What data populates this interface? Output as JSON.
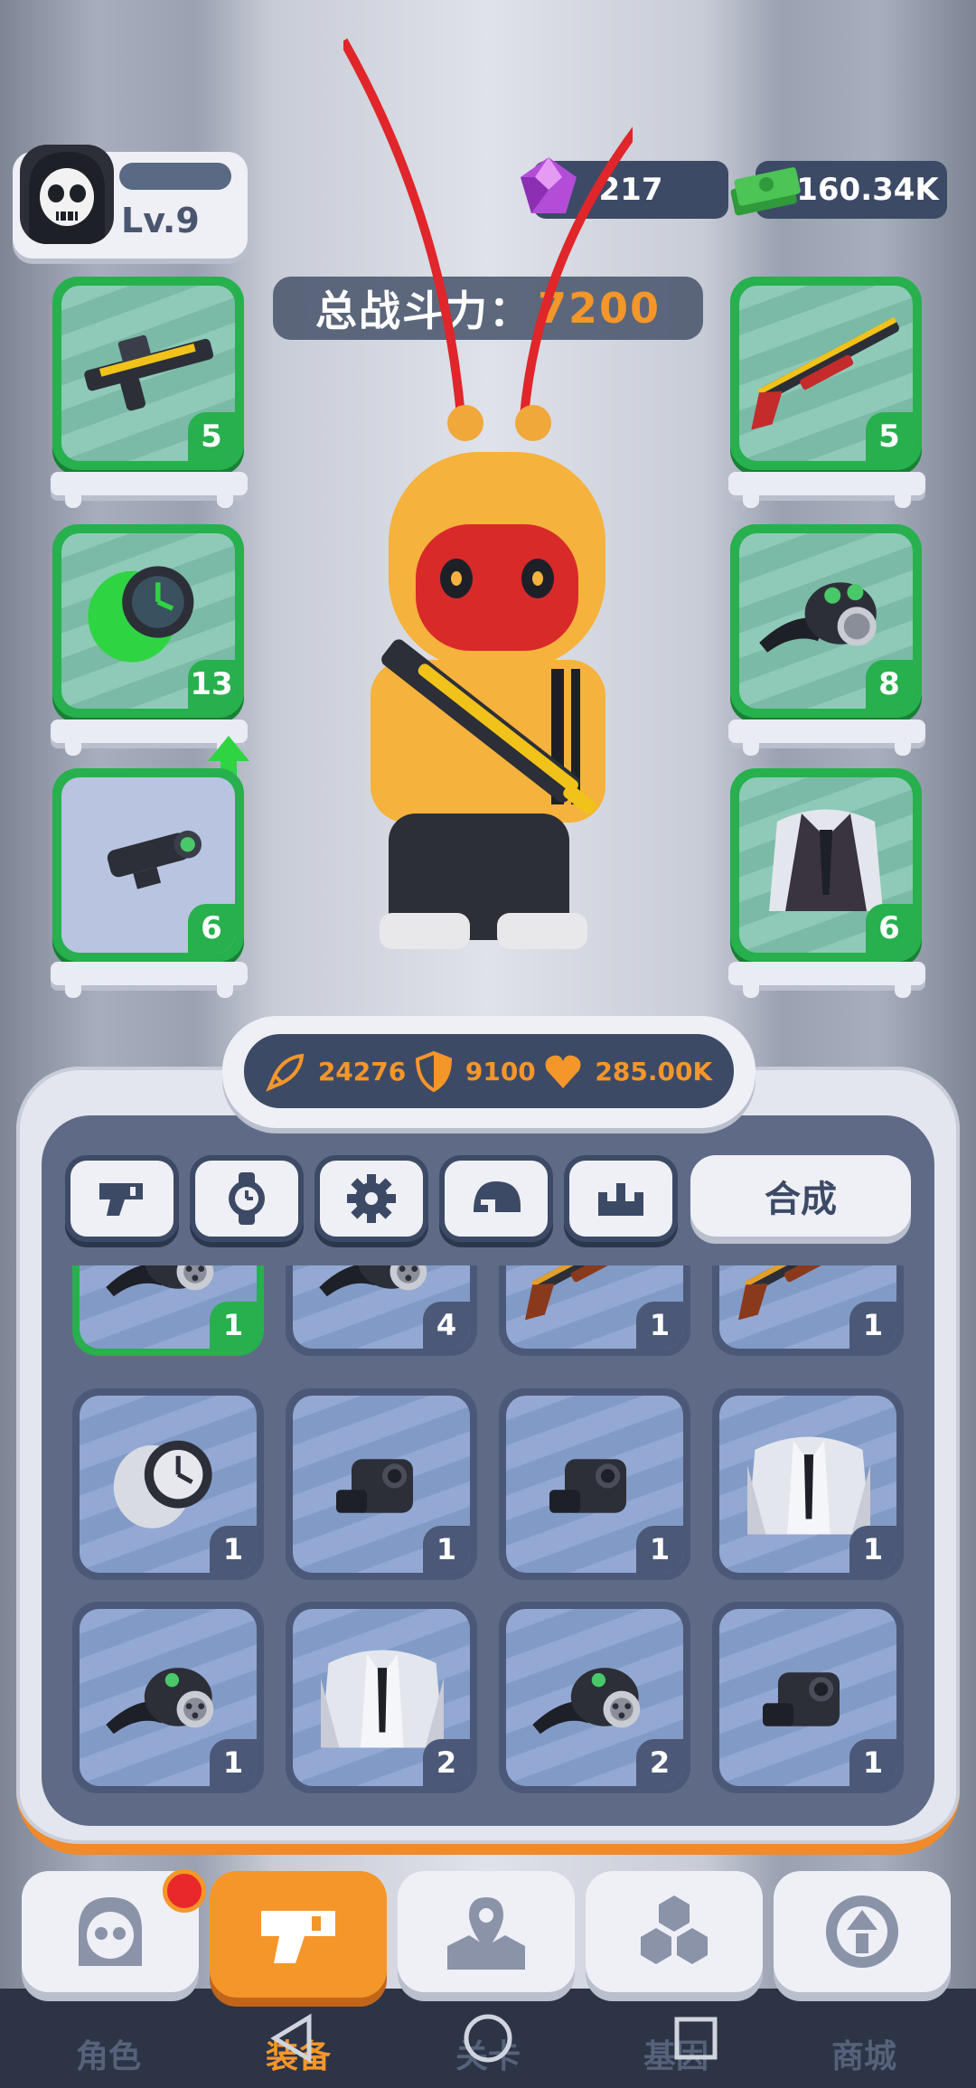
{
  "player": {
    "level": "Lv.9",
    "avatar_icon": "skull-hood-icon"
  },
  "currency": {
    "gems": "217",
    "cash": "160.34K"
  },
  "power": {
    "label": "总战斗力：",
    "value": "7200"
  },
  "equipment": {
    "left": [
      {
        "icon": "rifle-icon",
        "count": "5"
      },
      {
        "icon": "watch-icon",
        "count": "13"
      },
      {
        "icon": "scope-icon",
        "count": "6"
      }
    ],
    "right": [
      {
        "icon": "shotgun-icon",
        "count": "5"
      },
      {
        "icon": "gas-mask-icon",
        "count": "8"
      },
      {
        "icon": "vest-icon",
        "count": "6"
      }
    ]
  },
  "stats": {
    "attack": "24276",
    "defense": "9100",
    "health": "285.00K"
  },
  "tabs": [
    {
      "icon": "gun-icon"
    },
    {
      "icon": "watch-icon"
    },
    {
      "icon": "gear-icon"
    },
    {
      "icon": "helmet-icon"
    },
    {
      "icon": "crown-icon"
    }
  ],
  "merge_label": "合成",
  "inventory": [
    {
      "icon": "gas-mask-icon",
      "count": "1",
      "selected": true
    },
    {
      "icon": "gas-mask-icon",
      "count": "4"
    },
    {
      "icon": "shotgun-icon",
      "count": "1"
    },
    {
      "icon": "shotgun-icon",
      "count": "1"
    },
    {
      "icon": "watch-icon",
      "count": "1"
    },
    {
      "icon": "scope-icon",
      "count": "1"
    },
    {
      "icon": "scope-icon",
      "count": "1"
    },
    {
      "icon": "vest-icon",
      "count": "1"
    },
    {
      "icon": "gas-mask-icon",
      "count": "1"
    },
    {
      "icon": "vest-icon",
      "count": "2"
    },
    {
      "icon": "gas-mask-icon",
      "count": "2"
    },
    {
      "icon": "scope-icon",
      "count": "1"
    }
  ],
  "nav": [
    {
      "label": "角色",
      "icon": "skull-icon"
    },
    {
      "label": "装备",
      "icon": "gun-icon",
      "active": true
    },
    {
      "label": "关卡",
      "icon": "map-pin-icon"
    },
    {
      "label": "基因",
      "icon": "hexagons-icon"
    },
    {
      "label": "商城",
      "icon": "shop-icon"
    }
  ],
  "colors": {
    "accent": "#f5962a",
    "rarity_green": "#27b04d",
    "panel_dark": "#3d4a66"
  }
}
